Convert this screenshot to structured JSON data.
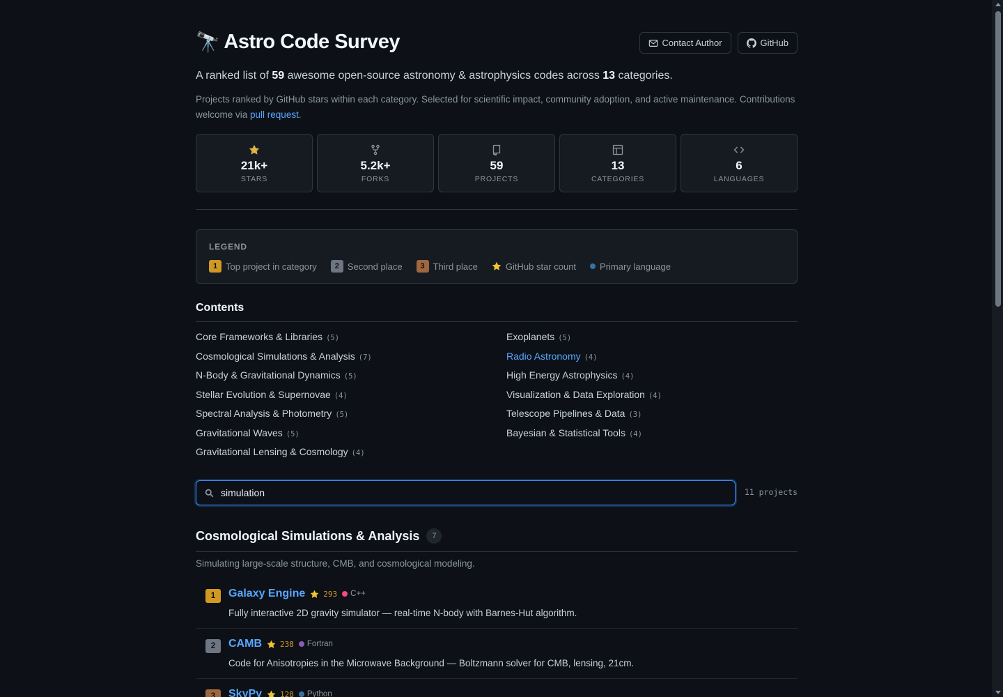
{
  "header": {
    "emoji": "🔭",
    "title": "Astro Code Survey",
    "contact_label": "Contact Author",
    "github_label": "GitHub"
  },
  "intro": {
    "prefix": "A ranked list of ",
    "project_total": "59",
    "middle": " awesome open-source astronomy & astrophysics codes across ",
    "category_total": "13",
    "suffix": " categories.",
    "desc_before": "Projects ranked by GitHub stars within each category. Selected for scientific impact, community adoption, and active maintenance. Contributions welcome via ",
    "desc_link": "pull request",
    "desc_after": "."
  },
  "stats": [
    {
      "icon": "star-icon",
      "value": "21k+",
      "label": "STARS"
    },
    {
      "icon": "fork-icon",
      "value": "5.2k+",
      "label": "FORKS"
    },
    {
      "icon": "repo-icon",
      "value": "59",
      "label": "PROJECTS"
    },
    {
      "icon": "table-icon",
      "value": "13",
      "label": "CATEGORIES"
    },
    {
      "icon": "code-icon",
      "value": "6",
      "label": "LANGUAGES"
    }
  ],
  "legend": {
    "title": "LEGEND",
    "rank1_num": "1",
    "rank1_text": "Top project in category",
    "rank2_num": "2",
    "rank2_text": "Second place",
    "rank3_num": "3",
    "rank3_text": "Third place",
    "star_text": "GitHub star count",
    "lang_text": "Primary language"
  },
  "contents": {
    "title": "Contents",
    "left": [
      {
        "name": "Core Frameworks & Libraries",
        "count": "(5)"
      },
      {
        "name": "Cosmological Simulations & Analysis",
        "count": "(7)"
      },
      {
        "name": "N-Body & Gravitational Dynamics",
        "count": "(5)"
      },
      {
        "name": "Stellar Evolution & Supernovae",
        "count": "(4)"
      },
      {
        "name": "Spectral Analysis & Photometry",
        "count": "(5)"
      },
      {
        "name": "Gravitational Waves",
        "count": "(5)"
      },
      {
        "name": "Gravitational Lensing & Cosmology",
        "count": "(4)"
      }
    ],
    "right": [
      {
        "name": "Exoplanets",
        "count": "(5)"
      },
      {
        "name": "Radio Astronomy",
        "count": "(4)"
      },
      {
        "name": "High Energy Astrophysics",
        "count": "(4)"
      },
      {
        "name": "Visualization & Data Exploration",
        "count": "(4)"
      },
      {
        "name": "Telescope Pipelines & Data",
        "count": "(3)"
      },
      {
        "name": "Bayesian & Statistical Tools",
        "count": "(4)"
      }
    ]
  },
  "search": {
    "value": "simulation",
    "result_count": "11 projects"
  },
  "section": {
    "title": "Cosmological Simulations & Analysis",
    "count": "7",
    "desc": "Simulating large-scale structure, CMB, and cosmological modeling."
  },
  "projects": [
    {
      "rank": "1",
      "name": "Galaxy Engine",
      "stars": "293",
      "lang": "C++",
      "lang_color": "#f34b7d",
      "desc": "Fully interactive 2D gravity simulator — real-time N-body with Barnes-Hut algorithm."
    },
    {
      "rank": "2",
      "name": "CAMB",
      "stars": "238",
      "lang": "Fortran",
      "lang_color": "#8a5cb8",
      "desc": "Code for Anisotropies in the Microwave Background — Boltzmann solver for CMB, lensing, 21cm."
    },
    {
      "rank": "3",
      "name": "SkyPy",
      "stars": "128",
      "lang": "Python",
      "lang_color": "#3572A5",
      "desc": ""
    }
  ],
  "colors": {
    "background": "#0d1117",
    "accent": "#58a6ff",
    "gold": "#d29922",
    "silver": "#6e7681",
    "bronze": "#a0673f"
  }
}
